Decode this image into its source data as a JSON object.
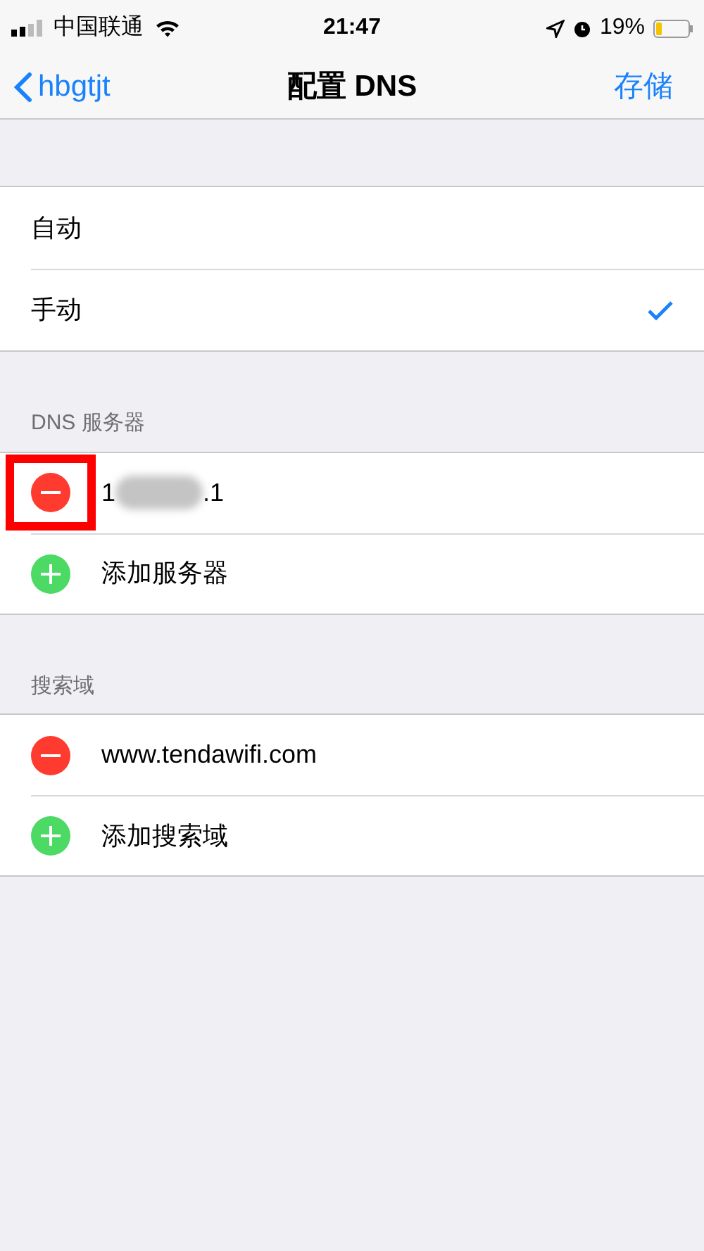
{
  "status_bar": {
    "carrier": "中国联通",
    "time": "21:47",
    "battery_percent": "19%",
    "battery": {
      "level": 0.19
    }
  },
  "nav": {
    "back": "hbgtjt",
    "title": "配置 DNS",
    "action": "存储"
  },
  "modes": [
    {
      "label": "自动",
      "selected": false
    },
    {
      "label": "手动",
      "selected": true
    }
  ],
  "sections": [
    {
      "header": "DNS 服务器",
      "rows": [
        {
          "kind": "remove",
          "text_start": "1",
          "text_end": ".1",
          "blurred": true,
          "highlighted": true
        },
        {
          "kind": "add",
          "label": "添加服务器"
        }
      ]
    },
    {
      "header": "搜索域",
      "rows": [
        {
          "kind": "remove",
          "text_start": "www.tendawifi.com",
          "highlighted": false
        },
        {
          "kind": "add",
          "label": "添加搜索域"
        }
      ]
    }
  ]
}
